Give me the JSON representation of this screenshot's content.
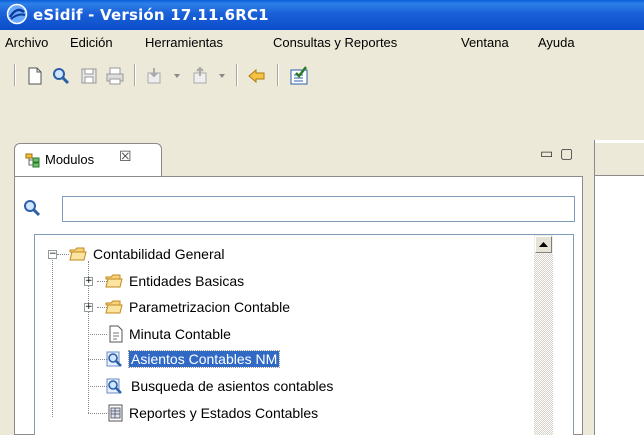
{
  "window": {
    "title": "eSidif - Versión 17.11.6RC1"
  },
  "menu": {
    "items": [
      {
        "label": "Archivo"
      },
      {
        "label": "Edición"
      },
      {
        "label": "Herramientas"
      },
      {
        "label": "Consultas y Reportes"
      },
      {
        "label": "Ventana"
      },
      {
        "label": "Ayuda"
      }
    ]
  },
  "toolbar": {
    "icons": [
      "new-document-icon",
      "search-icon",
      "save-icon",
      "print-icon",
      "import-icon",
      "export-icon",
      "back-arrow-icon",
      "checklist-icon"
    ]
  },
  "panel": {
    "tab_label": "Modulos",
    "search_value": "",
    "search_placeholder": ""
  },
  "tree": {
    "root": {
      "label": "Contabilidad General",
      "expanded": true
    },
    "children": [
      {
        "label": "Entidades Basicas",
        "type": "folder",
        "expandable": true
      },
      {
        "label": "Parametrizacion Contable",
        "type": "folder",
        "expandable": true
      },
      {
        "label": "Minuta Contable",
        "type": "document"
      },
      {
        "label": "Asientos Contables NM",
        "type": "search",
        "selected": true
      },
      {
        "label": "Busqueda de asientos contables",
        "type": "search"
      },
      {
        "label": "Reportes y Estados Contables",
        "type": "report"
      }
    ]
  },
  "colors": {
    "titlebar": "#0b4dc9",
    "selection": "#316ac5",
    "chrome": "#ece9d8"
  }
}
